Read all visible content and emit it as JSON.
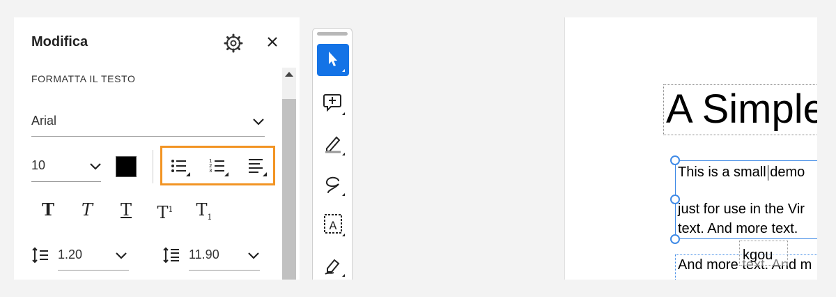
{
  "panel": {
    "title": "Modifica",
    "section_label": "FORMATTA IL TESTO",
    "font_family": "Arial",
    "font_size": "10",
    "text_color": "#000000",
    "highlight_color": "#f29423",
    "list_buttons": [
      "bulleted-list-icon",
      "numbered-list-icon",
      "align-left-icon"
    ],
    "style_buttons": {
      "bold": "T",
      "italic": "T",
      "underline": "T",
      "superscript": "T",
      "superscript_mark": "1",
      "subscript": "T",
      "subscript_mark": "1"
    },
    "line_spacing": "1.20",
    "paragraph_spacing": "11.90"
  },
  "toolbar": {
    "accent": "#1473e6",
    "tools": [
      "select-icon",
      "add-comment-icon",
      "highlight-icon",
      "draw-icon",
      "text-recognition-icon",
      "signature-icon"
    ]
  },
  "document": {
    "heading": "A Simple",
    "lines": [
      "This is a small demo",
      "just for use in the Vir",
      "text. And more text.",
      "And more text. And m"
    ],
    "tooltip": "kgou"
  }
}
